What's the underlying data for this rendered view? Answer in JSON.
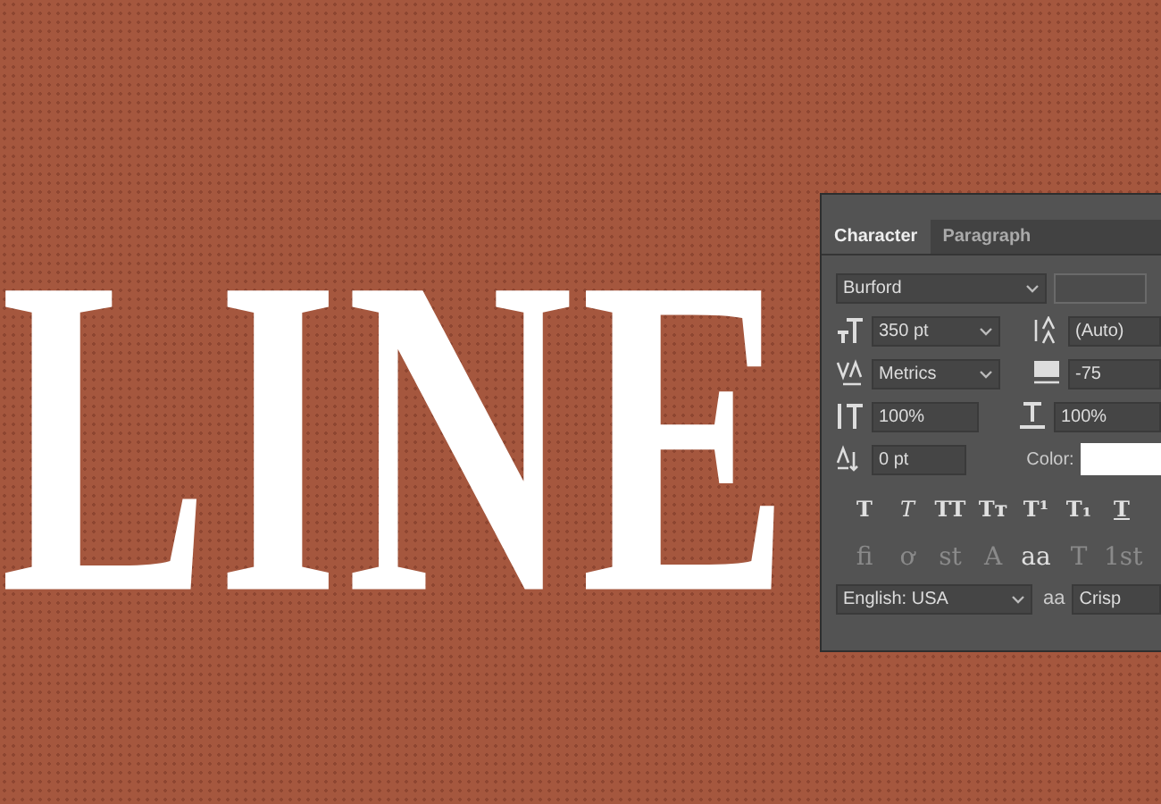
{
  "canvas": {
    "text": "LINE"
  },
  "panel": {
    "tabs": [
      {
        "label": "Character",
        "selected": true
      },
      {
        "label": "Paragraph",
        "selected": false
      }
    ],
    "font_family": "Burford",
    "font_style": {
      "disabled": true
    },
    "font_size": "350 pt",
    "leading": "(Auto)",
    "kerning": "Metrics",
    "tracking": "-75",
    "vertical_scale": "100%",
    "horizontal_scale": "100%",
    "baseline_shift": "0 pt",
    "color_label": "Color:",
    "color": "#ffffff",
    "style_buttons": [
      {
        "label": "T",
        "kind": "bold"
      },
      {
        "label": "T",
        "kind": "italic"
      },
      {
        "label": "TT",
        "kind": "caps"
      },
      {
        "label": "Tт",
        "kind": "smallcaps"
      },
      {
        "label": "T¹",
        "kind": "super"
      },
      {
        "label": "T₁",
        "kind": "sub"
      },
      {
        "label": "T",
        "kind": "underline"
      }
    ],
    "opentype_buttons": [
      {
        "label": "fi",
        "disabled": true
      },
      {
        "label": "ơ",
        "disabled": true
      },
      {
        "label": "st",
        "disabled": true
      },
      {
        "label": "A",
        "disabled": true
      },
      {
        "label": "aa",
        "disabled": false
      },
      {
        "label": "T",
        "disabled": true
      },
      {
        "label": "1st",
        "disabled": true
      }
    ],
    "language": "English: USA",
    "antialias_label": "aa",
    "antialias": "Crisp"
  }
}
